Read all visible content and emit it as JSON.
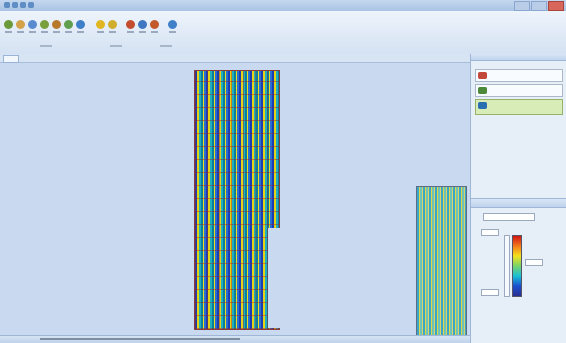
{
  "window": {
    "title": "",
    "qat_icons": [
      "app-icon",
      "save-icon",
      "undo-icon",
      "redo-icon"
    ]
  },
  "ribbon": {
    "buttons": [
      {
        "name": "tool-1-icon",
        "color": "#6a9a3a"
      },
      {
        "name": "tool-2-icon",
        "color": "#d4a24a"
      },
      {
        "name": "tool-3-icon",
        "color": "#5a8ad0"
      },
      {
        "name": "tool-4-icon",
        "color": "#7aa03e"
      },
      {
        "name": "tool-5-icon",
        "color": "#b77a2d"
      },
      {
        "name": "tool-6-icon",
        "color": "#5f9f4e"
      },
      {
        "name": "tool-7-icon",
        "color": "#3f7fc9"
      },
      {
        "name": "tool-8-icon",
        "color": "#e0b622"
      },
      {
        "name": "tool-9-icon",
        "color": "#d0ad2d"
      },
      {
        "name": "tool-10-icon",
        "color": "#c44d2f"
      },
      {
        "name": "tool-11-icon",
        "color": "#3e76c2"
      },
      {
        "name": "tool-12-icon",
        "color": "#c25a2a"
      },
      {
        "name": "tool-13-icon",
        "color": "#3f80c8"
      }
    ]
  },
  "document_tab": {
    "label": ""
  },
  "layers_panel": {
    "title": "",
    "items": [
      {
        "label": "",
        "thumb_color": "#c2483a",
        "selected": false
      },
      {
        "label": "",
        "thumb_color": "#4c8a3a",
        "selected": false
      },
      {
        "label": "",
        "thumb_color": "#2a6fb0",
        "selected": true
      }
    ]
  },
  "properties_panel": {
    "title": "",
    "colorbar_label": ""
  },
  "status_bar": {
    "text": ""
  },
  "colors": {
    "ribbon_bg": "#d4e2f3",
    "canvas_bg": "#c9daf0",
    "selected_layer": "#d8ecb7",
    "grid_line": "#8a3b3b"
  }
}
